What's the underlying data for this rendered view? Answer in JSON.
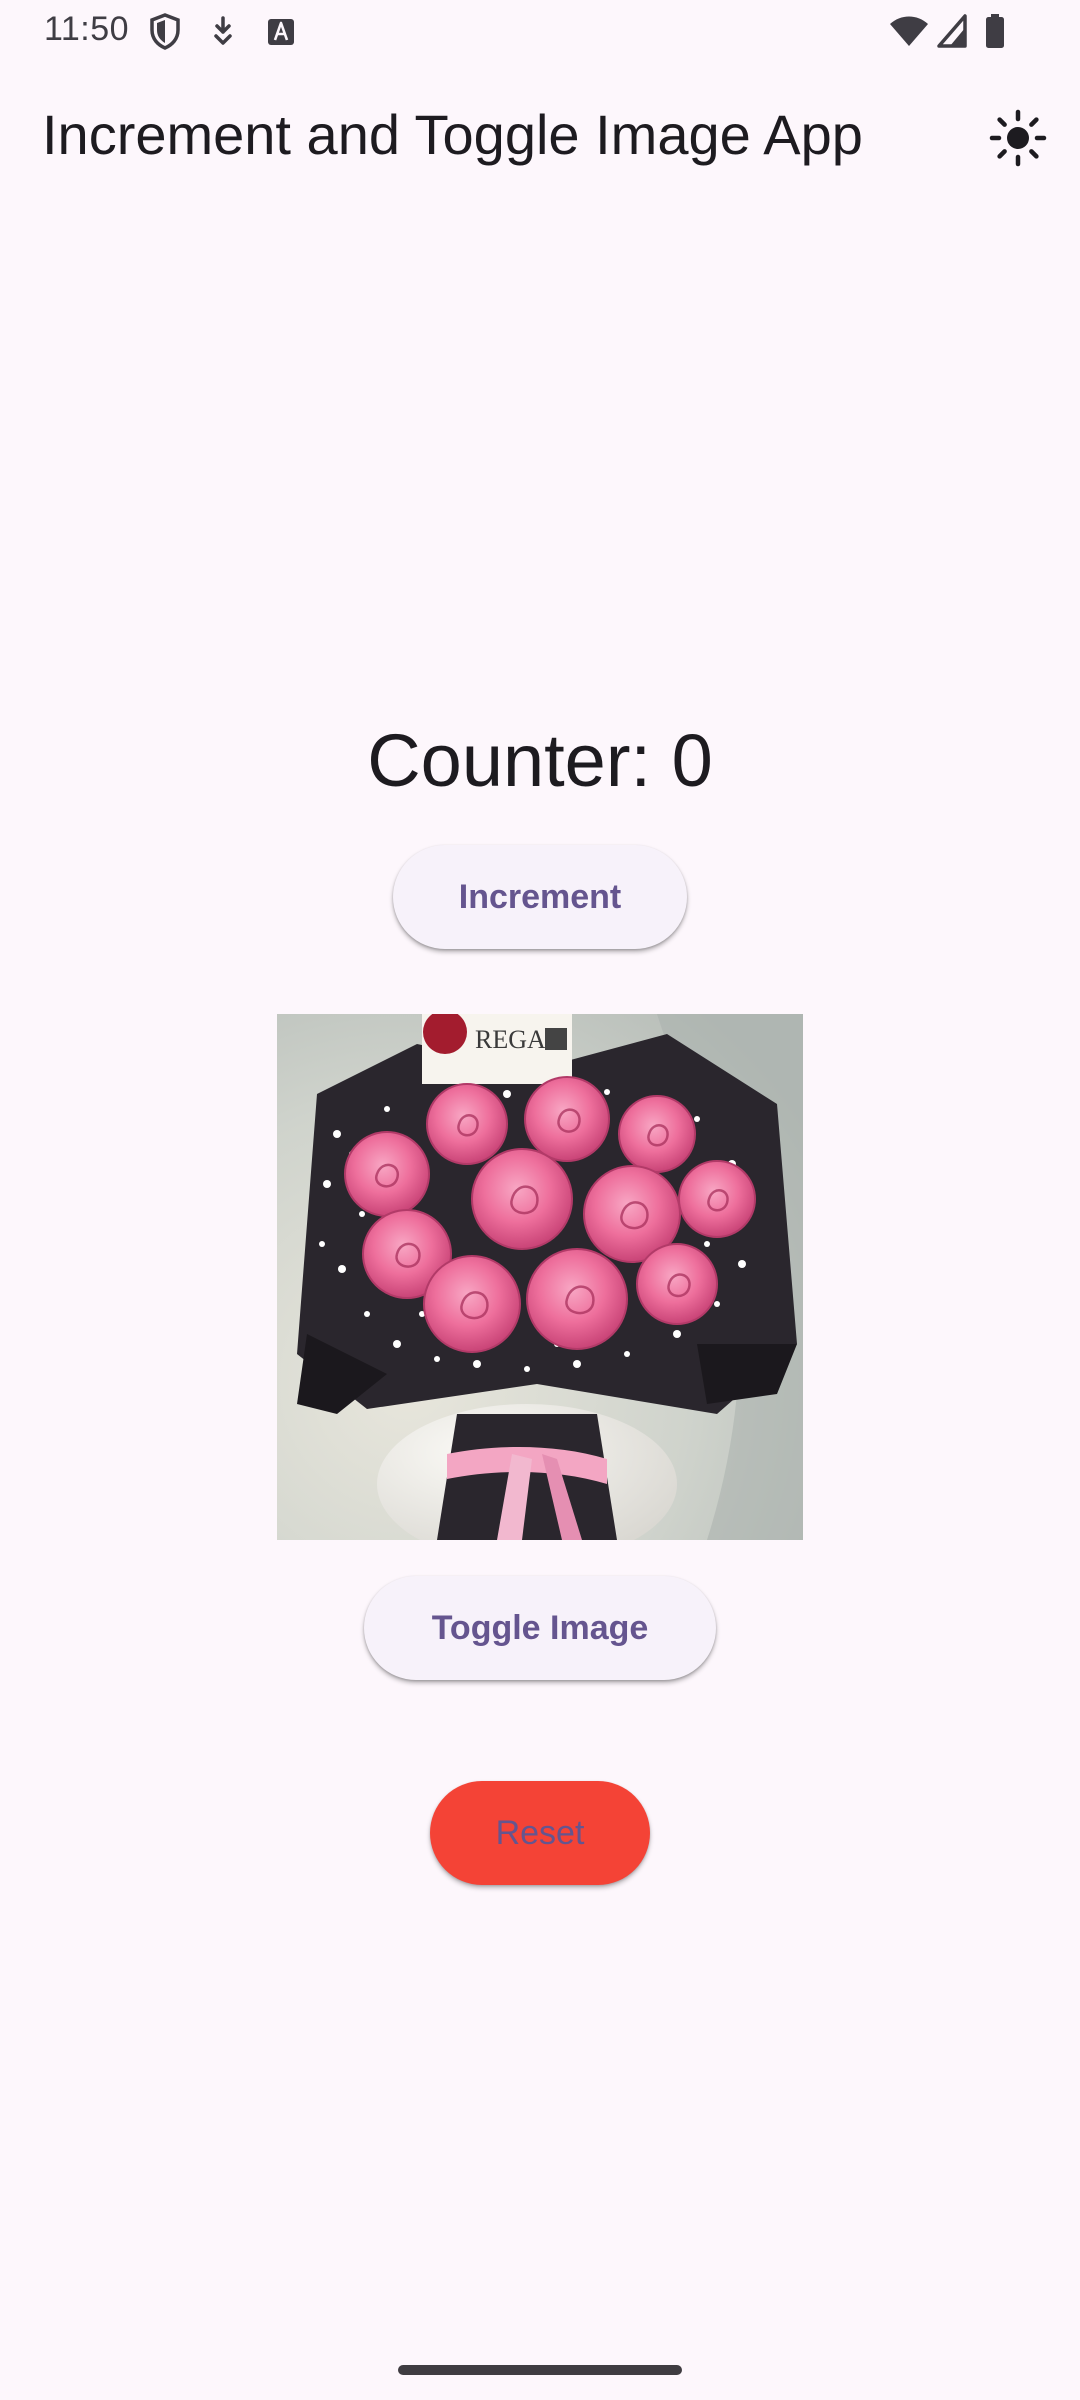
{
  "status_bar": {
    "time": "11:50",
    "left_icons": [
      "shield-icon",
      "download-badge-icon",
      "text-a-icon"
    ],
    "right_icons": [
      "wifi-icon",
      "signal-icon",
      "battery-icon"
    ]
  },
  "app_bar": {
    "title": "Increment and Toggle Image App",
    "theme_icon": "sun-icon"
  },
  "counter": {
    "label": "Counter: 0",
    "value": 0
  },
  "buttons": {
    "increment_label": "Increment",
    "toggle_label": "Toggle Image",
    "reset_label": "Reset"
  },
  "image": {
    "subject": "bouquet-of-pink-roses-image",
    "card_text": "REGAL"
  },
  "colors": {
    "background": "#fdf7fc",
    "button_text": "#65558f",
    "button_surface": "#f7f2fa",
    "reset_background": "#f44336"
  }
}
